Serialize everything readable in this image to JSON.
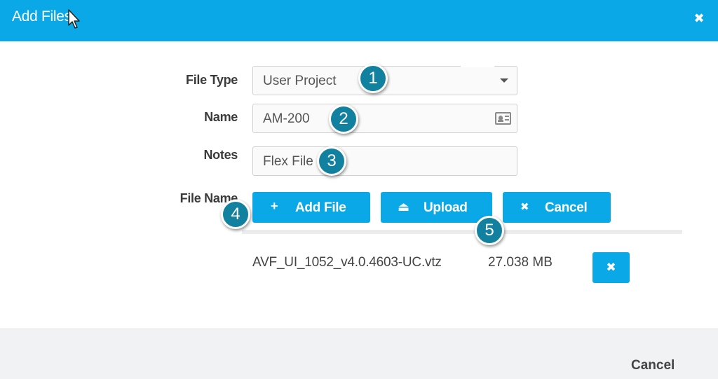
{
  "dialog": {
    "title": "Add Files",
    "close_glyph": "✖"
  },
  "form": {
    "file_type": {
      "label": "File Type",
      "value": "User Project"
    },
    "name": {
      "label": "Name",
      "value": "AM-200"
    },
    "notes": {
      "label": "Notes",
      "value": "Flex File"
    },
    "file_name": {
      "label": "File Name"
    }
  },
  "buttons": {
    "add_file": {
      "icon": "+",
      "label": "Add File"
    },
    "upload": {
      "icon": "⏏",
      "label": "Upload"
    },
    "cancel": {
      "icon": "✖",
      "label": "Cancel"
    }
  },
  "files": [
    {
      "name": "AVF_UI_1052_v4.0.4603-UC.vtz",
      "size": "27.038 MB",
      "remove_glyph": "✖"
    }
  ],
  "callouts": [
    "1",
    "2",
    "3",
    "4",
    "5"
  ],
  "footer": {
    "cancel_label": "Cancel"
  },
  "colors": {
    "accent": "#0aa8e6",
    "callout": "#12809f",
    "footer": "#f1f2f4"
  }
}
